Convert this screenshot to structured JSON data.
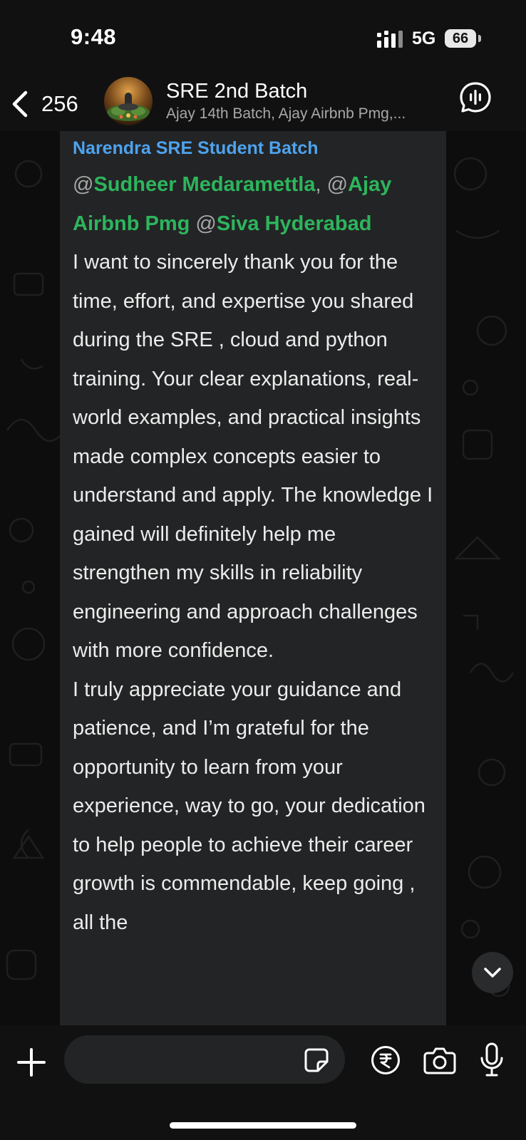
{
  "status_bar": {
    "time": "9:48",
    "network": "5G",
    "battery": "66"
  },
  "header": {
    "back_count": "256",
    "title": "SRE 2nd Batch",
    "subtitle": "Ajay 14th Batch, Ajay Airbnb Pmg,..."
  },
  "message": {
    "sender": "Narendra SRE Student Batch",
    "mentions": [
      "Sudheer Medaramettla",
      "Ajay Airbnb Pmg",
      "Siva Hyderabad"
    ],
    "at": "@",
    "comma": ",",
    "paragraph1": "I want to sincerely thank you for the time, effort, and expertise you shared during the SRE , cloud and python training. Your clear explanations, real-world examples, and practical insights made complex concepts easier to understand and apply. The knowledge I gained will definitely help me strengthen my skills in reliability engineering and approach challenges with more confidence.",
    "paragraph2": "I truly appreciate your guidance and patience, and I’m grateful for the opportunity to learn from your experience, way to go, your dedication to help people to achieve their career growth is commendable, keep going , all the"
  },
  "composer": {
    "input_value": "",
    "input_placeholder": ""
  },
  "colors": {
    "sender": "#4ea3ee",
    "mention": "#2db55d",
    "bubble": "#232425",
    "background": "#0b0b0b"
  },
  "icons": {
    "back": "chevron-left-icon",
    "call": "voice-chat-icon",
    "plus": "plus-icon",
    "sticker": "sticker-icon",
    "payment": "rupee-icon",
    "camera": "camera-icon",
    "mic": "microphone-icon",
    "scroll": "chevron-down-icon"
  }
}
